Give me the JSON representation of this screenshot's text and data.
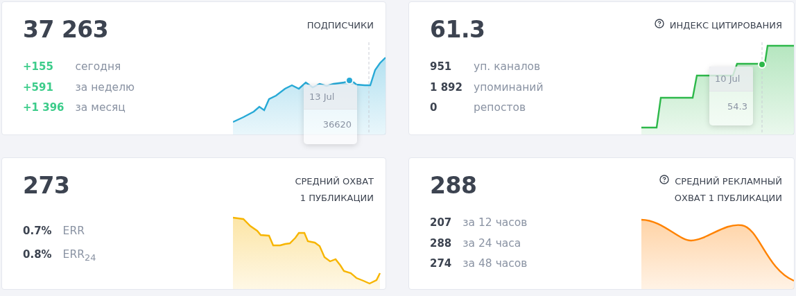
{
  "cards": [
    {
      "value": "37 263",
      "title_lines": [
        "ПОДПИСЧИКИ"
      ],
      "help": false,
      "positive": true,
      "stats": [
        {
          "value": "+155",
          "label": "сегодня"
        },
        {
          "value": "+591",
          "label": "за неделю"
        },
        {
          "value": "+1 396",
          "label": "за месяц"
        }
      ],
      "chart": {
        "kind": "rising",
        "color": "#27a9d6",
        "tooltip": {
          "date": "13 Jul",
          "value": "36620"
        }
      }
    },
    {
      "value": "61.3",
      "title_lines": [
        "ИНДЕКС ЦИТИРОВАНИЯ"
      ],
      "help": true,
      "positive": false,
      "stats": [
        {
          "value": "951",
          "label": "уп. каналов"
        },
        {
          "value": "1 892",
          "label": "упоминаний"
        },
        {
          "value": "0",
          "label": "репостов"
        }
      ],
      "chart": {
        "kind": "steps",
        "color": "#2db84a",
        "tooltip": {
          "date": "10 Jul",
          "value": "54.3"
        }
      }
    },
    {
      "value": "273",
      "title_lines": [
        "СРЕДНИЙ ОХВАТ",
        "1 ПУБЛИКАЦИИ"
      ],
      "help": false,
      "positive": false,
      "stats": [
        {
          "value": "0.7%",
          "label": "ERR"
        },
        {
          "value": "0.8%",
          "label": "ERR$_{24}$"
        }
      ],
      "chart": {
        "kind": "falling",
        "color": "#f7b500"
      }
    },
    {
      "value": "288",
      "title_lines": [
        "СРЕДНИЙ РЕКЛАМНЫЙ",
        "ОХВАТ 1 ПУБЛИКАЦИИ"
      ],
      "help": true,
      "positive": false,
      "stats": [
        {
          "value": "207",
          "label": "за 12 часов"
        },
        {
          "value": "288",
          "label": "за 24 часа"
        },
        {
          "value": "274",
          "label": "за 48 часов"
        }
      ],
      "chart": {
        "kind": "wave",
        "color": "#ff8200"
      }
    }
  ]
}
